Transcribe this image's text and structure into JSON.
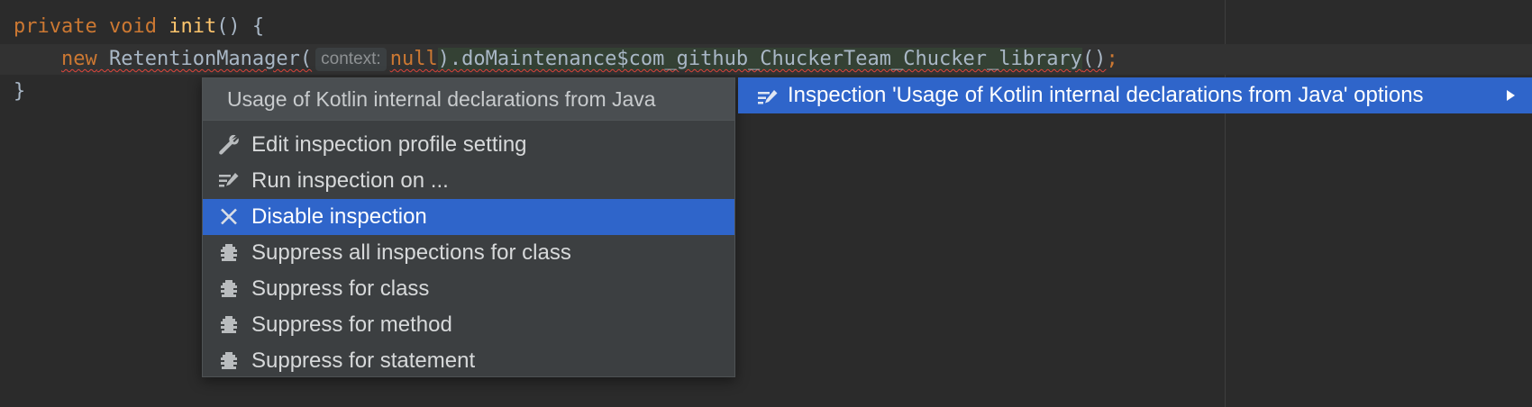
{
  "editor": {
    "line1": {
      "kw_private": "private",
      "kw_void": "void",
      "method": "init",
      "rest": "() {"
    },
    "line2": {
      "kw_new": "new",
      "class_name": "RetentionManager(",
      "param_hint": "context:",
      "kw_null": "null",
      "call": ").doMaintenance$com_github_ChuckerTeam_Chucker_library",
      "parens": "()",
      "semicolon": ";"
    },
    "line3": {
      "brace": "}"
    }
  },
  "context_menu": {
    "header": "Usage of Kotlin internal declarations from Java",
    "items": [
      {
        "label": "Edit inspection profile setting",
        "icon": "wrench-icon"
      },
      {
        "label": "Run inspection on ...",
        "icon": "run-inspection-icon"
      },
      {
        "label": "Disable inspection",
        "icon": "close-icon",
        "selected": true
      },
      {
        "label": "Suppress all inspections for class",
        "icon": "suppress-icon"
      },
      {
        "label": "Suppress for class",
        "icon": "suppress-icon"
      },
      {
        "label": "Suppress for method",
        "icon": "suppress-icon"
      },
      {
        "label": "Suppress for statement",
        "icon": "suppress-icon"
      }
    ]
  },
  "submenu": {
    "label": "Inspection 'Usage of Kotlin internal declarations from Java' options",
    "icon": "run-inspection-icon"
  },
  "colors": {
    "background": "#2b2b2b",
    "keyword": "#cc7832",
    "method": "#ffc66d",
    "selection": "#2f65ca",
    "error_underline": "#e0463c"
  }
}
